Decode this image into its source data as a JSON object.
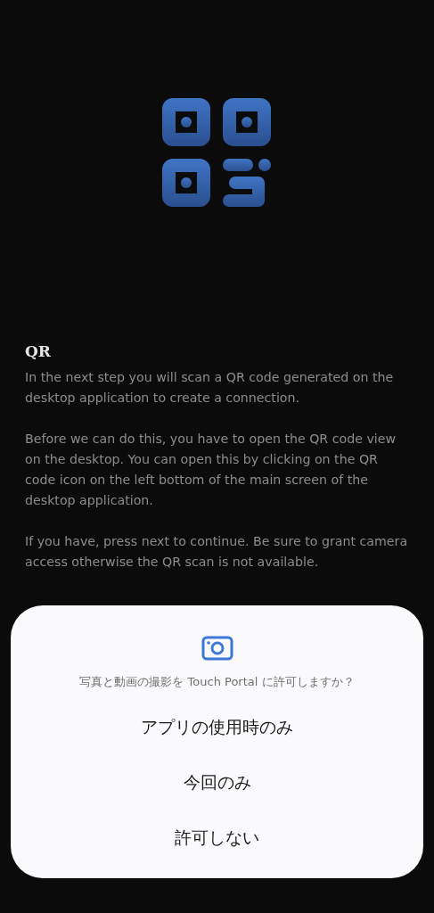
{
  "title": "QR",
  "paragraphs": [
    "In the next step you will scan a QR code generated on the desktop application to create a connection.",
    "Before we can do this, you have to open the QR code view on the desktop. You can open this by clicking on the QR code icon on the left bottom of the main screen of the desktop application.",
    "If you have, press next to continue. Be sure to grant camera access otherwise the QR scan is not available."
  ],
  "dialog": {
    "question": "写真と動画の撮影を Touch Portal に許可しますか？",
    "options": [
      "アプリの使用時のみ",
      "今回のみ",
      "許可しない"
    ]
  }
}
